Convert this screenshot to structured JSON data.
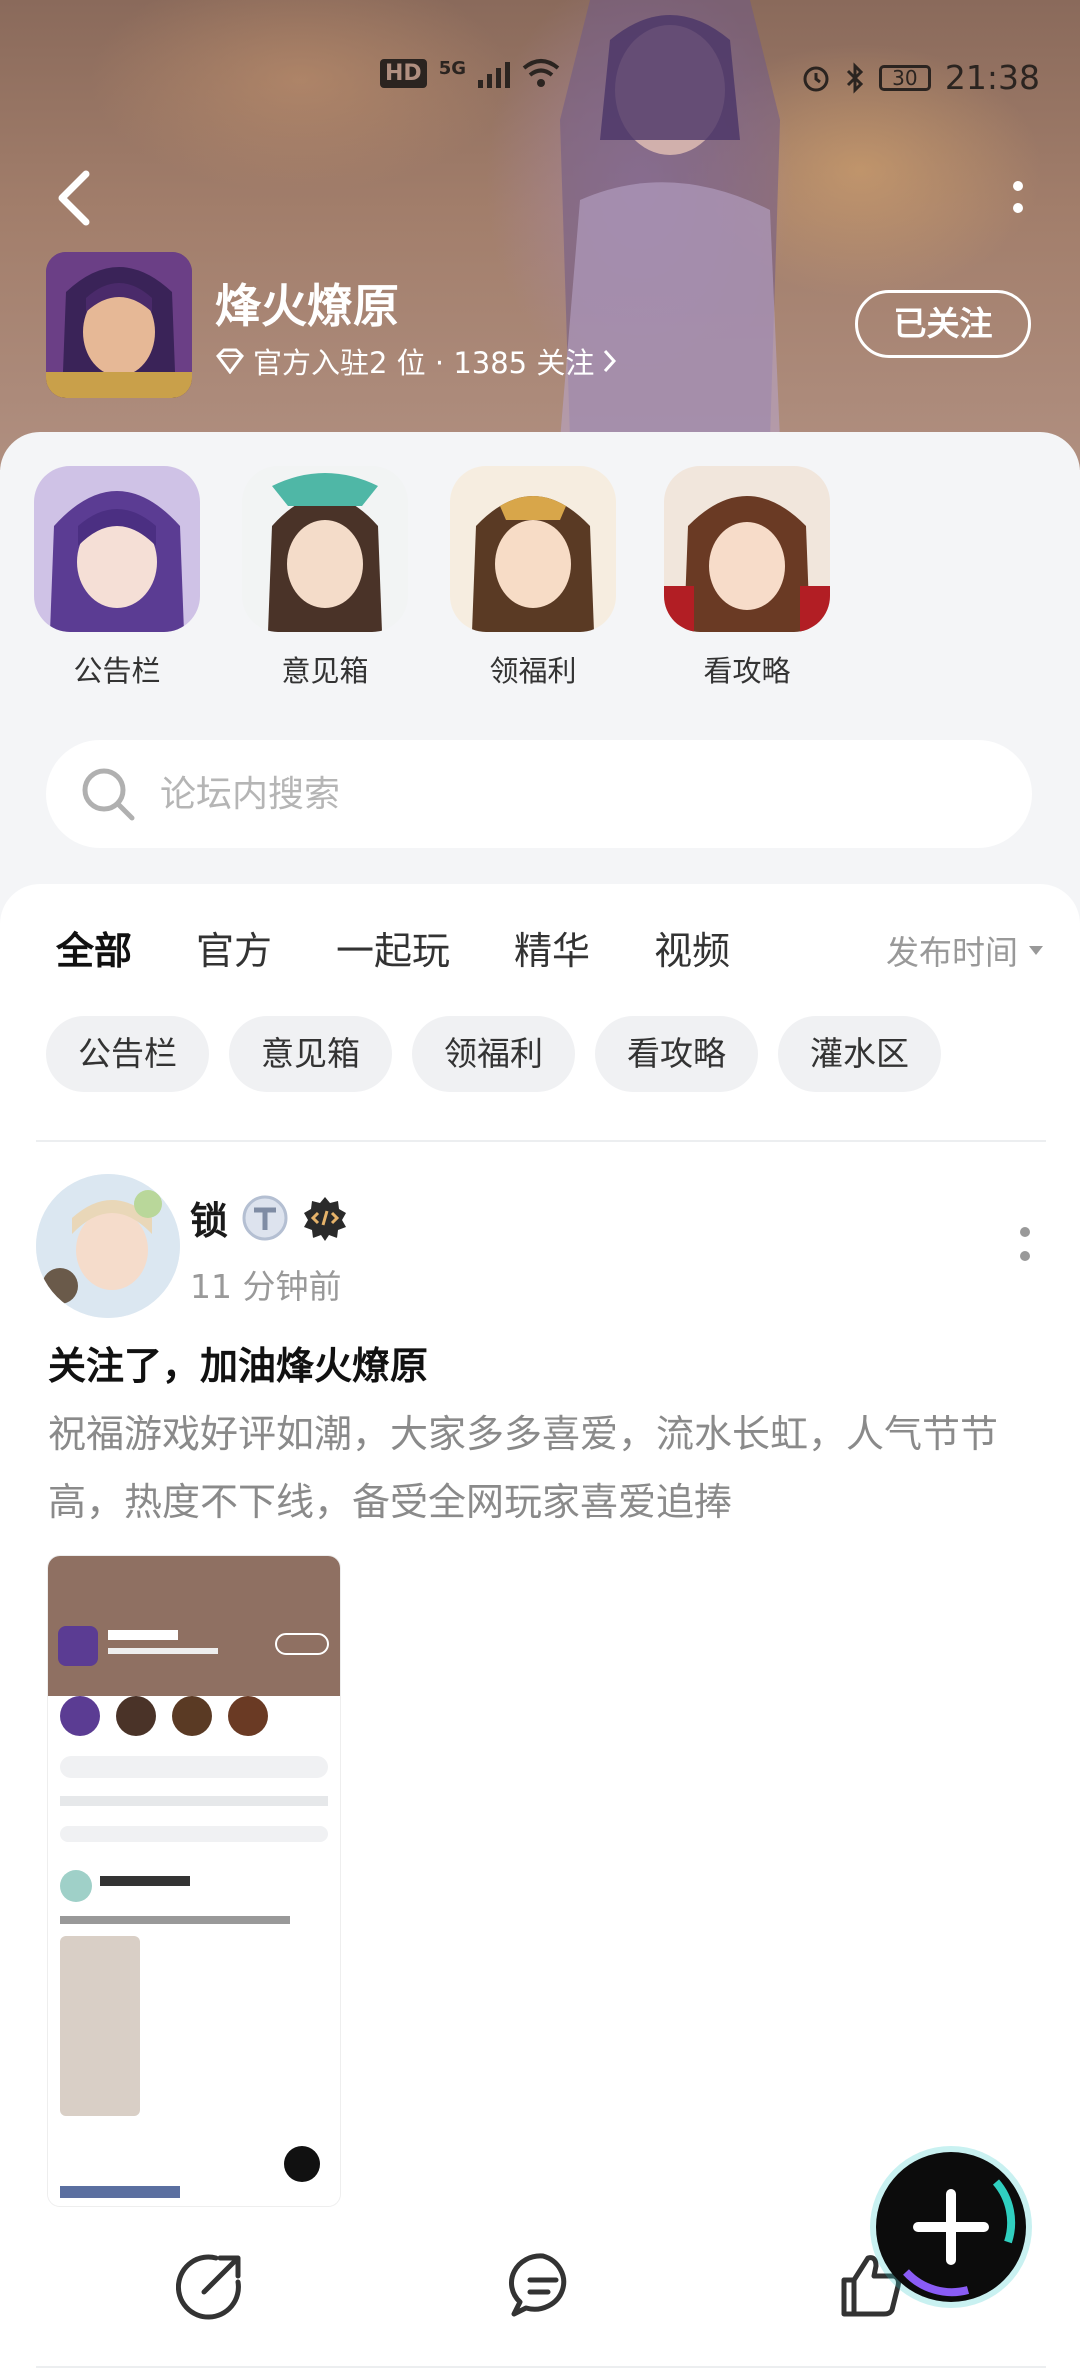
{
  "status_bar": {
    "hd": "HD",
    "net": "5G",
    "battery": "30",
    "time": "21:38"
  },
  "header": {
    "game_title": "烽火燎原",
    "subtitle": "官方入驻2 位 · 1385 关注",
    "follow_label": "已关注"
  },
  "shortcuts": [
    {
      "label": "公告栏"
    },
    {
      "label": "意见箱"
    },
    {
      "label": "领福利"
    },
    {
      "label": "看攻略"
    }
  ],
  "search": {
    "placeholder": "论坛内搜索"
  },
  "tabs": [
    "全部",
    "官方",
    "一起玩",
    "精华",
    "视频"
  ],
  "sort": {
    "label": "发布时间"
  },
  "chips": [
    "公告栏",
    "意见箱",
    "领福利",
    "看攻略",
    "灌水区"
  ],
  "post": {
    "user": "锁",
    "time": "11 分钟前",
    "title": "关注了，加油烽火燎原",
    "body": "祝福游戏好评如潮，大家多多喜爱，流水长虹，人气节节高，热度不下线，备受全网玩家喜爱追捧"
  },
  "colors": {
    "accent": "#2fd1c4",
    "fab": "#0c0c0c"
  }
}
